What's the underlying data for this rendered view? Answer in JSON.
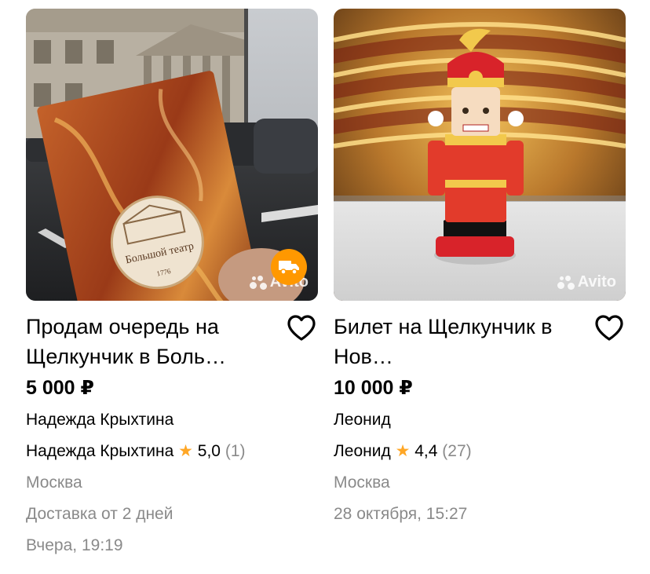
{
  "items": [
    {
      "title": "Продам очередь на Щелкунчик в Боль…",
      "price": "5 000 ₽",
      "seller": "Надежда Крыхтина",
      "seller_rating_name": "Надежда Крыхтина",
      "rating": "5,0",
      "reviews": "(1)",
      "location": "Москва",
      "delivery": "Доставка от 2 дней",
      "date": "Вчера, 19:19",
      "watermark": "Avito",
      "booklet_text": "Большой театр",
      "booklet_year": "1776",
      "has_delivery_badge": true
    },
    {
      "title": "Билет на Щелкунчик в Нов…",
      "price": "10 000 ₽",
      "seller": "Леонид",
      "seller_rating_name": "Леонид",
      "rating": "4,4",
      "reviews": "(27)",
      "location": "Москва",
      "date": "28 октября, 15:27",
      "watermark": "Avito",
      "has_delivery_badge": false
    }
  ],
  "colors": {
    "star": "#ffa726",
    "secondary_text": "#8a8a8a",
    "delivery_badge": "#ff9800"
  },
  "icons": {
    "favorite": "heart-outline-icon",
    "rating": "star-icon",
    "delivery": "truck-icon"
  }
}
